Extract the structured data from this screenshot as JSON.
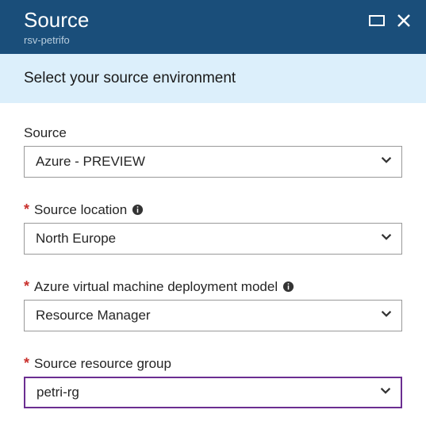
{
  "header": {
    "title": "Source",
    "subtitle": "rsv-petrifo"
  },
  "banner": "Select your source environment",
  "fields": {
    "source": {
      "label": "Source",
      "value": "Azure - PREVIEW",
      "required": false,
      "info": false
    },
    "location": {
      "label": "Source location",
      "value": "North Europe",
      "required": true,
      "info": true
    },
    "deployment": {
      "label": "Azure virtual machine deployment model",
      "value": "Resource Manager",
      "required": true,
      "info": true
    },
    "rg": {
      "label": "Source resource group",
      "value": "petri-rg",
      "required": true,
      "info": false
    }
  }
}
